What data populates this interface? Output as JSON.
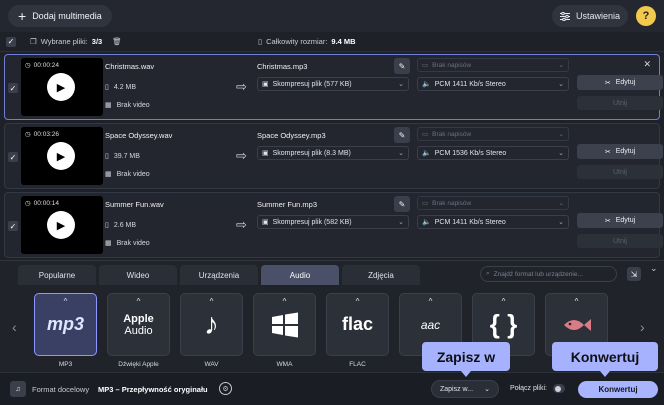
{
  "topbar": {
    "add_label": "Dodaj multimedia",
    "settings_label": "Ustawienia",
    "help_label": "?"
  },
  "summary": {
    "selected_label": "Wybrane pliki:",
    "selected_value": "3/3",
    "size_label": "Całkowity rozmiar:",
    "size_value": "9.4 MB"
  },
  "files": [
    {
      "time": "00:00:24",
      "src_name": "Christmas.wav",
      "src_size": "4.2 MB",
      "video": "Brak video",
      "out_name": "Christmas.mp3",
      "compress": "Skompresuj plik (577 KB)",
      "subs": "Brak napisów",
      "audio": "PCM 1411 Kb/s Stereo",
      "edit": "Edytuj",
      "trim": "Utnij"
    },
    {
      "time": "00:03:26",
      "src_name": "Space Odyssey.wav",
      "src_size": "39.7 MB",
      "video": "Brak video",
      "out_name": "Space Odyssey.mp3",
      "compress": "Skompresuj plik (8.3 MB)",
      "subs": "Brak napisów",
      "audio": "PCM 1536 Kb/s Stereo",
      "edit": "Edytuj",
      "trim": "Utnij"
    },
    {
      "time": "00:00:14",
      "src_name": "Summer Fun.wav",
      "src_size": "2.6 MB",
      "video": "Brak video",
      "out_name": "Summer Fun.mp3",
      "compress": "Skompresuj plik (582 KB)",
      "subs": "Brak napisów",
      "audio": "PCM 1411 Kb/s Stereo",
      "edit": "Edytuj",
      "trim": "Utnij"
    }
  ],
  "tabs": [
    "Popularne",
    "Wideo",
    "Urządzenia",
    "Audio",
    "Zdjęcia"
  ],
  "active_tab": "Audio",
  "search_placeholder": "Znajdź format lub urządzenie...",
  "formats": [
    {
      "label": "MP3",
      "icon": "mp3-logo"
    },
    {
      "label": "Dźwięki Apple",
      "icon": "apple-audio-logo",
      "logo_line1": "Apple",
      "logo_line2": "Audio"
    },
    {
      "label": "WAV",
      "icon": "music-note-icon"
    },
    {
      "label": "WMA",
      "icon": "windows-logo"
    },
    {
      "label": "FLAC",
      "icon": "flac-logo",
      "logo_text": "flac"
    },
    {
      "label": "",
      "icon": "aac-logo",
      "logo_text": "aac"
    },
    {
      "label": "",
      "icon": "braces-icon",
      "logo_text": "{ }"
    },
    {
      "label": "",
      "icon": "fish-icon"
    }
  ],
  "bottom": {
    "format_label": "Format docelowy",
    "format_value": "MP3 – Przepływność oryginału",
    "save_label": "Zapisz w...",
    "merge_label": "Połącz pliki:",
    "convert_label": "Konwertuj"
  },
  "tooltips": {
    "save": "Zapisz w",
    "convert": "Konwertuj"
  },
  "colors": {
    "accent": "#a9b4ff",
    "help": "#f2c94c",
    "background": "#1e2128"
  }
}
